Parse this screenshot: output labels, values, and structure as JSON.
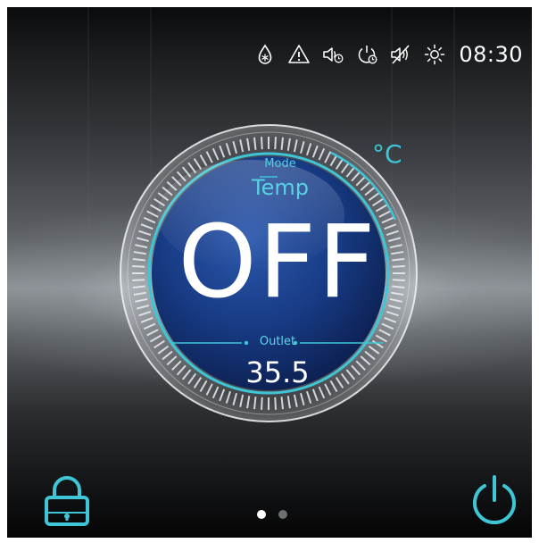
{
  "status_bar": {
    "icons": [
      "defrost-drop-icon",
      "warning-triangle-icon",
      "sound-timer-icon",
      "power-timer-icon",
      "mute-icon",
      "sun-icon"
    ],
    "time": "08:30"
  },
  "dial": {
    "unit": "°C",
    "mode_label": "Mode",
    "mode_value": "Temp",
    "power_state": "OFF",
    "outlet_label": "Outlet",
    "outlet_value": "35.5"
  },
  "controls": {
    "lock_icon": "lock-icon",
    "power_icon": "power-icon"
  },
  "pager": {
    "pages": 2,
    "active": 1
  },
  "colors": {
    "accent": "#3ec6d6",
    "dial_face": "#17357a",
    "text": "#ffffff"
  }
}
